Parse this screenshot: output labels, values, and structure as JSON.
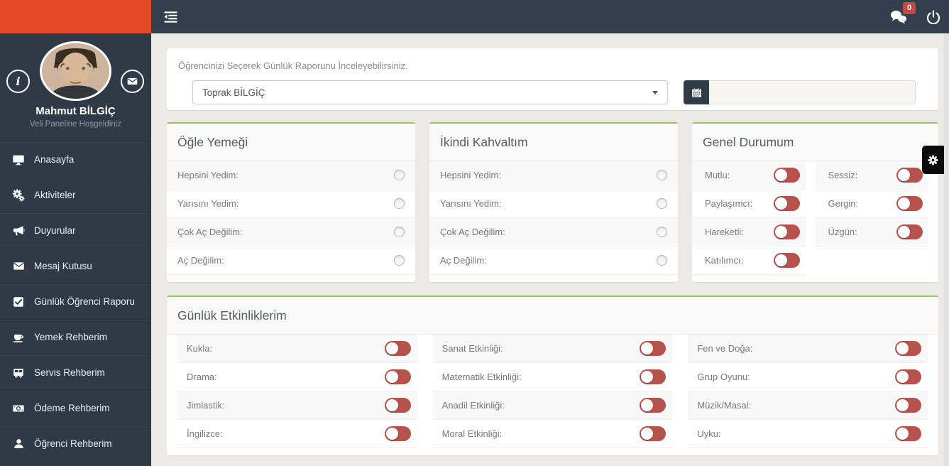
{
  "topbar": {
    "chat_badge": "0"
  },
  "sidebar": {
    "user_name": "Mahmut BİLGİÇ",
    "welcome": "Veli Paneline Hoşgeldiniz",
    "items": [
      {
        "label": "Anasayfa",
        "icon": "desktop-icon"
      },
      {
        "label": "Aktiviteler",
        "icon": "gears-icon"
      },
      {
        "label": "Duyurular",
        "icon": "megaphone-icon"
      },
      {
        "label": "Mesaj Kutusu",
        "icon": "envelope-icon"
      },
      {
        "label": "Günlük Öğrenci Raporu",
        "icon": "check-square-icon"
      },
      {
        "label": "Yemek Rehberim",
        "icon": "cup-icon"
      },
      {
        "label": "Servis Rehberim",
        "icon": "bus-icon"
      },
      {
        "label": "Ödeme Rehberim",
        "icon": "money-icon"
      },
      {
        "label": "Öğrenci Rehberim",
        "icon": "user-icon"
      }
    ]
  },
  "report_selector": {
    "instruction": "Öğrencinizi Seçerek Günlük Raporunu İnceleyebilirsiniz.",
    "student_value": "Toprak BİLGİÇ",
    "date_value": ""
  },
  "panels": {
    "lunch": {
      "title": "Öğle Yemeği",
      "rows": [
        "Hepsini Yedim:",
        "Yarısını Yedim:",
        "Çok Aç Değilim:",
        "Aç Değilim:"
      ]
    },
    "snack": {
      "title": "İkindi Kahvaltım",
      "rows": [
        "Hepsini Yedim:",
        "Yarısını Yedim:",
        "Çok Aç Değilim:",
        "Aç Değilim:"
      ]
    },
    "mood": {
      "title": "Genel Durumum",
      "left": [
        "Mutlu:",
        "Paylaşımcı:",
        "Hareketli:",
        "Katılımcı:"
      ],
      "right": [
        "Sessiz:",
        "Gergin:",
        "Üzgün:"
      ]
    },
    "activities": {
      "title": "Günlük Etkinliklerim",
      "columns": [
        [
          "Kukla:",
          "Drama:",
          "Jimlastik:",
          "İngilizce:"
        ],
        [
          "Sanat Etkinliği:",
          "Matematik Etkinliği:",
          "Anadil Etkinliği:",
          "Moral Etkinliği:"
        ],
        [
          "Fen ve Doğa:",
          "Grup Oyunu:",
          "Müzik/Masal:",
          "Uyku:"
        ]
      ]
    }
  },
  "state": {
    "all_toggles": "off",
    "all_radios": "unselected"
  },
  "colors": {
    "accent_orange": "#e34a26",
    "dark_bar": "#333f4c",
    "dark_sidebar": "#2f3a46",
    "panel_green": "#9dbf60",
    "toggle_red": "#b5524c",
    "badge_red": "#c04a45"
  }
}
